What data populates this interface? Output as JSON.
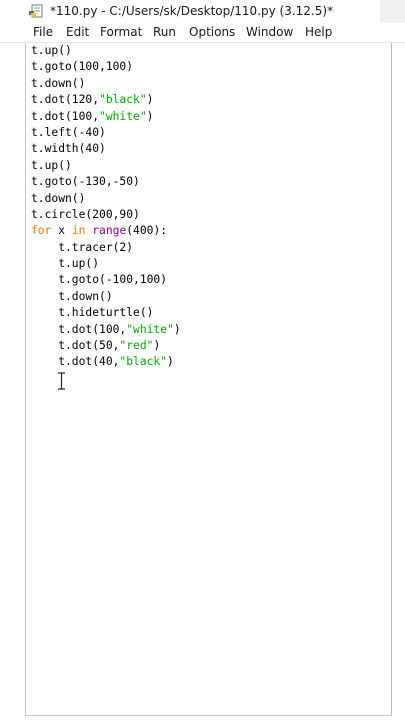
{
  "window": {
    "title": "*110.py - C:/Users/sk/Desktop/110.py (3.12.5)*",
    "icon": "python-file-icon"
  },
  "menu": [
    "File",
    "Edit",
    "Format",
    "Run",
    "Options",
    "Window",
    "Help"
  ],
  "colors": {
    "keyword": "#ff7700",
    "builtin": "#900090",
    "string": "#00aa00",
    "default": "#000000"
  },
  "code_lines": [
    [
      {
        "t": "t.up()",
        "c": "default"
      }
    ],
    [
      {
        "t": "t.goto(100,100)",
        "c": "default"
      }
    ],
    [
      {
        "t": "t.down()",
        "c": "default"
      }
    ],
    [
      {
        "t": "t.dot(120,",
        "c": "default"
      },
      {
        "t": "\"black\"",
        "c": "string"
      },
      {
        "t": ")",
        "c": "default"
      }
    ],
    [
      {
        "t": "t.dot(100,",
        "c": "default"
      },
      {
        "t": "\"white\"",
        "c": "string"
      },
      {
        "t": ")",
        "c": "default"
      }
    ],
    [
      {
        "t": "t.left(-40)",
        "c": "default"
      }
    ],
    [
      {
        "t": "t.width(40)",
        "c": "default"
      }
    ],
    [
      {
        "t": "t.up()",
        "c": "default"
      }
    ],
    [
      {
        "t": "t.goto(-130,-50)",
        "c": "default"
      }
    ],
    [
      {
        "t": "t.down()",
        "c": "default"
      }
    ],
    [
      {
        "t": "t.circle(200,90)",
        "c": "default"
      }
    ],
    [
      {
        "t": "for",
        "c": "keyword"
      },
      {
        "t": " x ",
        "c": "default"
      },
      {
        "t": "in",
        "c": "keyword"
      },
      {
        "t": " ",
        "c": "default"
      },
      {
        "t": "range",
        "c": "builtin"
      },
      {
        "t": "(400):",
        "c": "default"
      }
    ],
    [
      {
        "t": "    t.tracer(2)",
        "c": "default"
      }
    ],
    [
      {
        "t": "    t.up()",
        "c": "default"
      }
    ],
    [
      {
        "t": "    t.goto(-100,100)",
        "c": "default"
      }
    ],
    [
      {
        "t": "    t.down()",
        "c": "default"
      }
    ],
    [
      {
        "t": "    t.hideturtle()",
        "c": "default"
      }
    ],
    [
      {
        "t": "    t.dot(100,",
        "c": "default"
      },
      {
        "t": "\"white\"",
        "c": "string"
      },
      {
        "t": ")",
        "c": "default"
      }
    ],
    [
      {
        "t": "    t.dot(50,",
        "c": "default"
      },
      {
        "t": "\"red\"",
        "c": "string"
      },
      {
        "t": ")",
        "c": "default"
      }
    ],
    [
      {
        "t": "    t.dot(40,",
        "c": "default"
      },
      {
        "t": "\"black\"",
        "c": "string"
      },
      {
        "t": ")",
        "c": "default"
      }
    ]
  ]
}
